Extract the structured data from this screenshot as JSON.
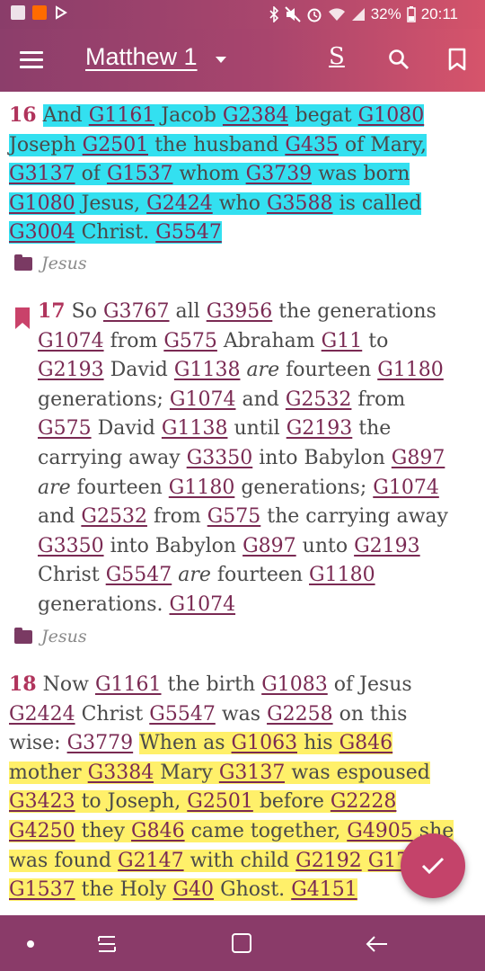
{
  "status_bar": {
    "battery": "32%",
    "time": "20:11",
    "icons": [
      "gallery-icon",
      "app-notification-icon",
      "play-store-icon",
      "bluetooth-icon",
      "mute-icon",
      "alarm-icon",
      "wifi-icon",
      "signal-icon",
      "battery-icon"
    ]
  },
  "toolbar": {
    "title": "Matthew 1",
    "strongs_label": "S",
    "icons": [
      "menu-icon",
      "chevron-down-icon",
      "search-icon",
      "bookmark-icon"
    ]
  },
  "verses": [
    {
      "number": "16",
      "tokens": [
        "And",
        "G1161",
        "Jacob",
        "G2384",
        "begat",
        "G1080",
        "Joseph",
        "G2501",
        "the husband",
        "G435",
        "of Mary,",
        "G3137",
        "of",
        "G1537",
        "whom",
        "G3739",
        "was born",
        "G1080",
        "Jesus,",
        "G2424",
        "who",
        "G3588",
        "is called",
        "G3004",
        "Christ.",
        "G5547"
      ],
      "highlight": "cyan",
      "tag": "Jesus"
    },
    {
      "number": "17",
      "tokens": [
        "So",
        "G3767",
        "all",
        "G3956",
        "the generations",
        "G1074",
        "from",
        "G575",
        "Abraham",
        "G11",
        "to",
        "G2193",
        "David",
        "G1138",
        "are",
        "fourteen",
        "G1180",
        "generations;",
        "G1074",
        "and",
        "G2532",
        "from",
        "G575",
        "David",
        "G1138",
        "until",
        "G2193",
        "the carrying away",
        "G3350",
        "into Babylon",
        "G897",
        "are",
        "fourteen",
        "G1180",
        "generations;",
        "G1074",
        "and",
        "G2532",
        "from",
        "G575",
        "the carrying away",
        "G3350",
        "into Babylon",
        "G897",
        "unto",
        "G2193",
        "Christ",
        "G5547",
        "are",
        "fourteen",
        "G1180",
        "generations.",
        "G1074"
      ],
      "bookmarked": true,
      "tag": "Jesus"
    },
    {
      "number": "18",
      "tokens": [
        "Now",
        "G1161",
        "the birth",
        "G1083",
        "of Jesus",
        "G2424",
        "Christ",
        "G5547",
        "was",
        "G2258",
        "on this wise:",
        "G3779",
        "When as",
        "G1063",
        "his",
        "G846",
        "mother",
        "G3384",
        "Mary",
        "G3137",
        "was espoused",
        "G3423",
        "to Joseph,",
        "G2501",
        "before",
        "G2228",
        "G4250",
        "they",
        "G846",
        "came together,",
        "G4905",
        "she was found",
        "G2147",
        "with child",
        "G2192",
        "G1722",
        "G1537",
        "the Holy",
        "G40",
        "Ghost.",
        "G4151"
      ],
      "highlight": "yellow"
    }
  ],
  "fab": {
    "icon": "check-icon"
  },
  "navbar": {
    "icons": [
      "nav-dot-icon",
      "recent-apps-icon",
      "home-icon",
      "back-icon"
    ]
  }
}
